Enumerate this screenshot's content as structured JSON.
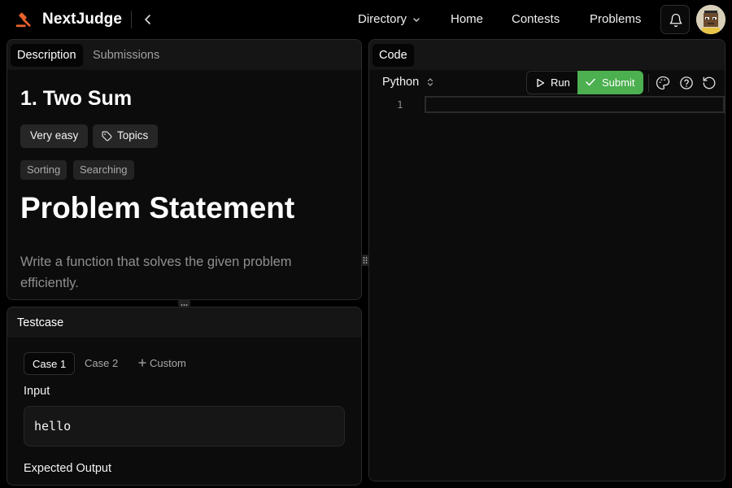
{
  "header": {
    "brand": "NextJudge",
    "nav": {
      "directory": "Directory",
      "home": "Home",
      "contests": "Contests",
      "problems": "Problems"
    }
  },
  "description_panel": {
    "tabs": {
      "description": "Description",
      "submissions": "Submissions"
    },
    "problem_title": "1. Two Sum",
    "difficulty": "Very easy",
    "topics_label": "Topics",
    "topics": [
      "Sorting",
      "Searching"
    ],
    "statement_heading": "Problem Statement",
    "statement_text": "Write a function that solves the given problem efficiently."
  },
  "testcase_panel": {
    "title": "Testcase",
    "cases": [
      "Case 1",
      "Case 2"
    ],
    "custom_label": "Custom",
    "input_label": "Input",
    "input_value": "hello",
    "expected_label": "Expected Output"
  },
  "code_panel": {
    "tab": "Code",
    "language": "Python",
    "run_label": "Run",
    "submit_label": "Submit",
    "line_numbers": [
      "1"
    ]
  },
  "colors": {
    "accent_green": "#4caf50",
    "logo_orange": "#e8622c"
  },
  "icons": [
    "gavel-logo-icon",
    "chevron-left-icon",
    "chevron-down-icon",
    "bell-icon",
    "tag-icon",
    "play-icon",
    "check-icon",
    "palette-icon",
    "help-circle-icon",
    "reset-icon",
    "plus-icon",
    "chevrons-up-down-icon"
  ]
}
